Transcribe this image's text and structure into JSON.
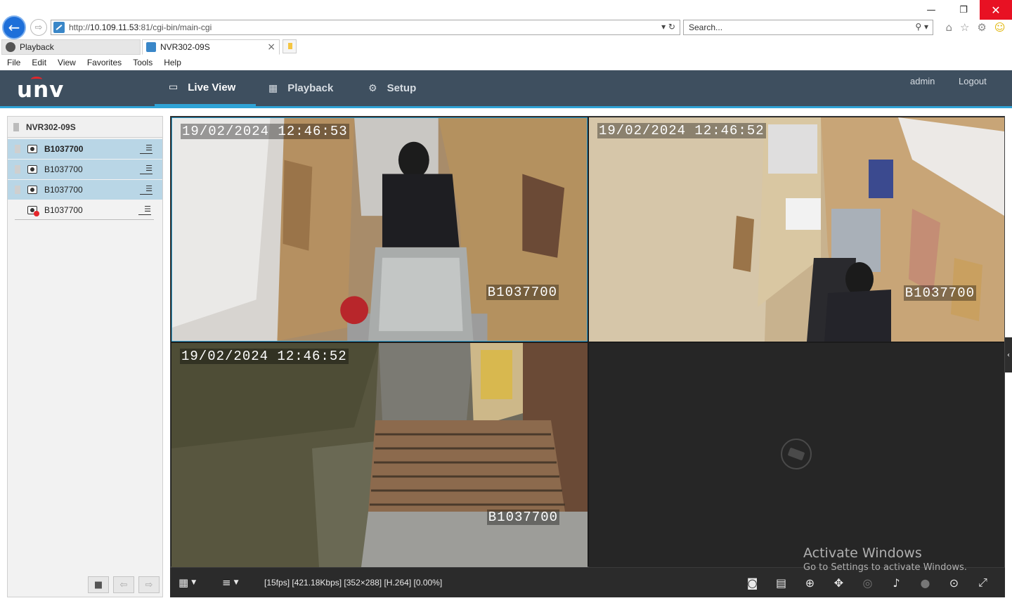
{
  "browser": {
    "url_prefix": "http://",
    "url_host": "10.109.11.53",
    "url_path": ":81/cgi-bin/main-cgi",
    "search_placeholder": "Search...",
    "tabs": [
      {
        "label": "Playback"
      },
      {
        "label": "NVR302-09S"
      }
    ],
    "menu": [
      "File",
      "Edit",
      "View",
      "Favorites",
      "Tools",
      "Help"
    ]
  },
  "app": {
    "logo": "unv",
    "nav": [
      {
        "label": "Live View",
        "icon": "monitor-icon",
        "active": true
      },
      {
        "label": "Playback",
        "icon": "calendar-icon"
      },
      {
        "label": "Setup",
        "icon": "gear-icon"
      }
    ],
    "user": "admin",
    "logout": "Logout"
  },
  "device_tree": {
    "root": "NVR302-09S",
    "cameras": [
      {
        "name": "B1037700",
        "status": "online",
        "selected": true,
        "bold": true
      },
      {
        "name": "B1037700",
        "status": "online",
        "selected": true
      },
      {
        "name": "B1037700",
        "status": "online",
        "selected": true
      },
      {
        "name": "B1037700",
        "status": "offline",
        "selected": false
      }
    ]
  },
  "video": {
    "panes": [
      {
        "timestamp": "19/02/2024 12:46:53",
        "label": "B1037700",
        "active": true
      },
      {
        "timestamp": "19/02/2024 12:46:52",
        "label": "B1037700"
      },
      {
        "timestamp": "19/02/2024 12:46:52",
        "label": "B1037700"
      },
      {
        "timestamp": "",
        "label": "",
        "empty": true
      }
    ],
    "stream_info": "[15fps] [421.18Kbps] [352×288] [H.264] [0.00%]"
  },
  "watermark": {
    "title": "Activate Windows",
    "subtitle": "Go to Settings to activate Windows."
  },
  "colors": {
    "header_bg": "#3e4f5f",
    "accent": "#2fa3d6",
    "selected_row": "#b9d6e6",
    "close_red": "#e81123"
  }
}
